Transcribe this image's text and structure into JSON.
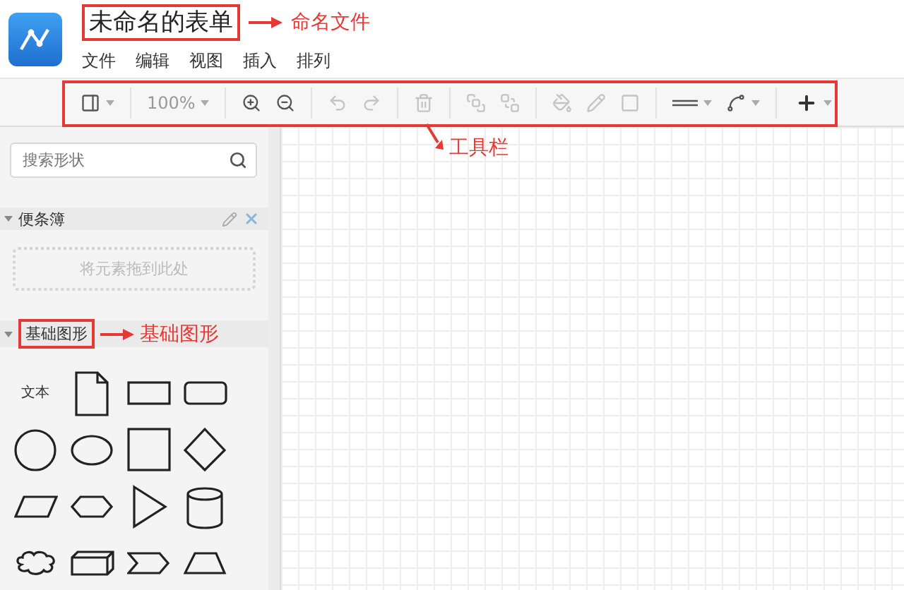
{
  "app": {
    "title": "未命名的表单",
    "annotation": "命名文件",
    "menu": [
      "文件",
      "编辑",
      "视图",
      "插入",
      "排列"
    ]
  },
  "toolbar": {
    "groups": [
      [
        {
          "kind": "layout",
          "disabled": false
        }
      ],
      [
        {
          "kind": "zoom",
          "value": "100%",
          "disabled": false
        }
      ],
      [
        {
          "kind": "zoom_in",
          "disabled": false
        },
        {
          "kind": "zoom_out",
          "disabled": false
        }
      ],
      [
        {
          "kind": "undo",
          "disabled": true
        },
        {
          "kind": "redo",
          "disabled": true
        }
      ],
      [
        {
          "kind": "delete",
          "disabled": true
        }
      ],
      [
        {
          "kind": "to_front",
          "disabled": true
        },
        {
          "kind": "to_back",
          "disabled": true
        }
      ],
      [
        {
          "kind": "fill",
          "disabled": true
        },
        {
          "kind": "line_color",
          "disabled": true
        },
        {
          "kind": "shadow",
          "disabled": true
        }
      ],
      [
        {
          "kind": "line_style",
          "disabled": false
        },
        {
          "kind": "connector",
          "disabled": false
        }
      ]
    ],
    "add": {
      "kind": "add",
      "disabled": false
    },
    "annotation": "工具栏"
  },
  "sidebar": {
    "search": {
      "placeholder": "搜索形状"
    },
    "sections": [
      {
        "kind": "notes",
        "title": "便条簿",
        "expanded": true,
        "drop_hint": "将元素拖到此处"
      },
      {
        "kind": "shapes",
        "title": "基础图形",
        "annotation": "基础图形",
        "expanded": true,
        "shapes": [
          {
            "kind": "text",
            "label": "文本"
          },
          {
            "kind": "document"
          },
          {
            "kind": "rect"
          },
          {
            "kind": "rounded_rect"
          },
          {
            "kind": "circle"
          },
          {
            "kind": "ellipse"
          },
          {
            "kind": "square"
          },
          {
            "kind": "diamond"
          },
          {
            "kind": "parallelogram"
          },
          {
            "kind": "hexagon"
          },
          {
            "kind": "triangle"
          },
          {
            "kind": "cylinder"
          },
          {
            "kind": "cloud"
          },
          {
            "kind": "cube"
          },
          {
            "kind": "step"
          },
          {
            "kind": "trapezoid"
          }
        ]
      }
    ]
  }
}
